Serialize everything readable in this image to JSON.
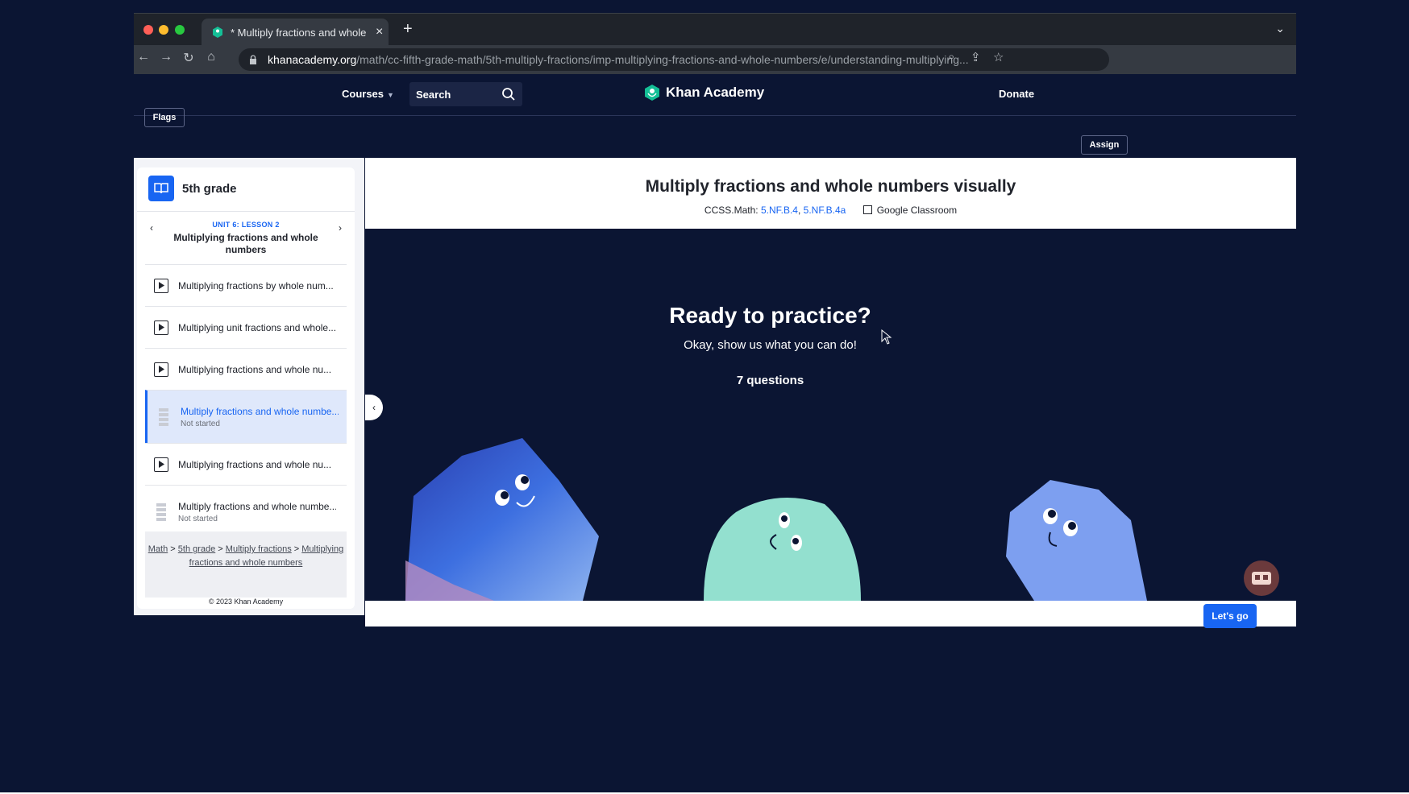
{
  "browser": {
    "tab_title": "* Multiply fractions and whole n",
    "url_host": "khanacademy.org",
    "url_path": "/math/cc-fifth-grade-math/5th-multiply-fractions/imp-multiplying-fractions-and-whole-numbers/e/understanding-multiplying..."
  },
  "header": {
    "courses": "Courses",
    "search_label": "Search",
    "logo_text": "Khan Academy",
    "donate": "Donate"
  },
  "toolbar": {
    "flags": "Flags",
    "assign": "Assign"
  },
  "sidebar": {
    "course": "5th grade",
    "unit_label": "UNIT 6: LESSON 2",
    "unit_title": "Multiplying fractions and whole numbers",
    "items": [
      {
        "label": "Multiplying fractions by whole num...",
        "type": "video"
      },
      {
        "label": "Multiplying unit fractions and whole...",
        "type": "video"
      },
      {
        "label": "Multiplying fractions and whole nu...",
        "type": "video"
      },
      {
        "label": "Multiply fractions and whole numbe...",
        "type": "exercise",
        "status": "Not started"
      },
      {
        "label": "Multiplying fractions and whole nu...",
        "type": "video"
      },
      {
        "label": "Multiply fractions and whole numbe...",
        "type": "exercise",
        "status": "Not started"
      }
    ],
    "breadcrumb": {
      "math": "Math",
      "grade": "5th grade",
      "unit": "Multiply fractions",
      "lesson": "Multiplying fractions and whole numbers"
    },
    "copyright": "© 2023 Khan Academy"
  },
  "main": {
    "title": "Multiply fractions and whole numbers visually",
    "standards_prefix": "CCSS.Math:",
    "standard_1": "5.NF.B.4",
    "standard_2": "5.NF.B.4a",
    "google_classroom": "Google Classroom",
    "ready_title": "Ready to practice?",
    "ready_subtitle": "Okay, show us what you can do!",
    "question_count": "7 questions",
    "lets_go": "Let's go"
  },
  "colors": {
    "accent": "#1865f2",
    "background": "#0b1533"
  }
}
